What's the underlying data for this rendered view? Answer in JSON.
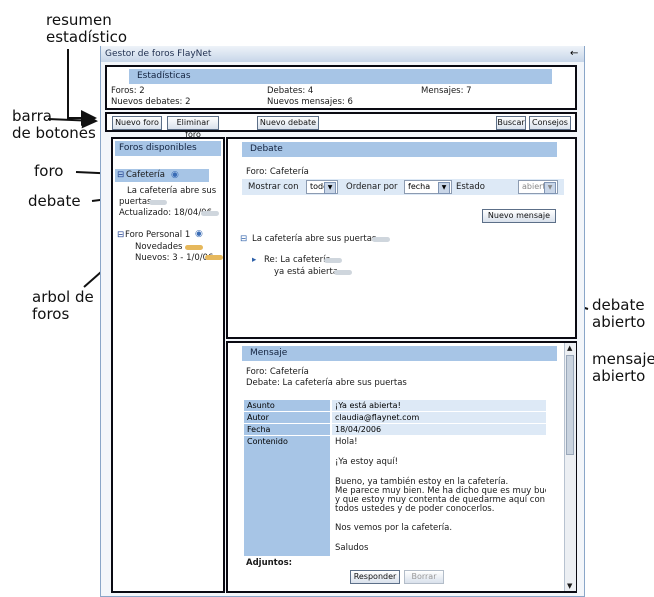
{
  "annotations": {
    "resumen": [
      "resumen",
      "estadístico"
    ],
    "barra": [
      "barra",
      "de botones"
    ],
    "foro": "foro",
    "debate": "debate",
    "arbol": [
      "arbol de",
      "foros"
    ],
    "debate_abierto": [
      "debate",
      "abierto"
    ],
    "mensaje_abierto": [
      "mensaje",
      "abierto"
    ]
  },
  "window": {
    "title": "Gestor de foros FlayNet"
  },
  "stats": {
    "header": "Estadísticas",
    "foros": "Foros: 2",
    "debates": "Debates: 4",
    "mensajes": "Mensajes: 7",
    "nuevos_debates": "Nuevos debates: 2",
    "nuevos_mensajes": "Nuevos mensajes: 6"
  },
  "toolbar": {
    "nuevo_foro": "Nuevo foro",
    "eliminar_foro": "Eliminar foro",
    "nuevo_debate": "Nuevo debate",
    "buscar": "Buscar",
    "consejos": "Consejos"
  },
  "forums": {
    "header": "Foros disponibles",
    "items": [
      {
        "name": "Cafetería",
        "debate_lines": [
          "La cafetería abre sus",
          "puertas",
          "Actualizado: 18/04/06"
        ]
      },
      {
        "name": "Foro Personal 1",
        "debate_lines": [
          "Novedades",
          "Nuevos: 3 - 1/0/06"
        ]
      }
    ]
  },
  "debate": {
    "header": "Debate",
    "forum_label": "Foro: Cafetería",
    "filter": {
      "mostrar_label": "Mostrar con",
      "mostrar_value": "todos",
      "ordenar_label": "Ordenar por",
      "ordenar_value": "fecha",
      "estado_label": "Estado",
      "estado_value": "abierto"
    },
    "new_message_button": "Nuevo mensaje",
    "topic": "La cafetería abre sus puertas",
    "replies": [
      "Re: La cafetería",
      "ya está abierta"
    ]
  },
  "message": {
    "header": "Mensaje",
    "foro_line": "Foro: Cafetería",
    "debate_line": "Debate: La cafetería abre sus puertas",
    "fields": {
      "asunto_label": "Asunto",
      "asunto_value": "¡Ya está abierta!",
      "autor_label": "Autor",
      "autor_value": "claudia@flaynet.com",
      "fecha_label": "Fecha",
      "fecha_value": "18/04/2006",
      "contenido_label": "Contenido"
    },
    "body_lines": [
      "Hola!",
      "",
      "¡Ya estoy aquí!",
      "",
      "Bueno, ya también estoy en la cafetería.",
      "Me parece muy bien. Me ha dicho que es muy buen sitio",
      "y que estoy muy contenta de quedarme aquí con",
      "todos ustedes y de poder conocerlos.",
      "",
      "Nos vemos por la cafetería.",
      "",
      "Saludos"
    ],
    "adjuntos_label": "Adjuntos:",
    "responder_button": "Responder",
    "borrar_button": "Borrar"
  },
  "colors": {
    "accent": "#a7c5e6",
    "frame": "#0a0a12"
  }
}
